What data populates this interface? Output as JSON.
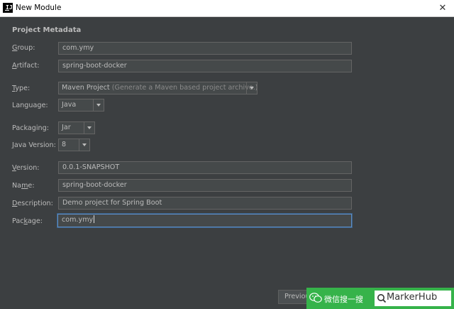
{
  "window": {
    "title": "New Module",
    "app_icon_text": "IJ"
  },
  "section_title": "Project Metadata",
  "form": {
    "group": {
      "label_u": "G",
      "label_rest": "roup:",
      "value": "com.ymy"
    },
    "artifact": {
      "label_u": "A",
      "label_rest": "rtifact:",
      "value": "spring-boot-docker"
    },
    "type": {
      "label_u": "T",
      "label_rest": "ype:",
      "value": "Maven Project",
      "hint": "(Generate a Maven based project archive.)"
    },
    "language": {
      "label": "Language:",
      "value": "Java"
    },
    "packaging": {
      "label": "Packaging:",
      "value": "Jar"
    },
    "java_version": {
      "label_u": "J",
      "label_rest": "ava Version:",
      "value": "8"
    },
    "version": {
      "label_u": "V",
      "label_rest": "ersion:",
      "value": "0.0.1-SNAPSHOT"
    },
    "name": {
      "label_pre": "Na",
      "label_u": "m",
      "label_rest": "e:",
      "value": "spring-boot-docker"
    },
    "description": {
      "label_u": "D",
      "label_rest": "escription:",
      "value": "Demo project for Spring Boot"
    },
    "package": {
      "label_pre": "Pac",
      "label_u": "k",
      "label_rest": "age:",
      "value": "com.ymy"
    }
  },
  "buttons": {
    "previous": "Previous"
  },
  "watermark": {
    "text": "微信搜一搜",
    "search_text": "MarkerHub"
  }
}
